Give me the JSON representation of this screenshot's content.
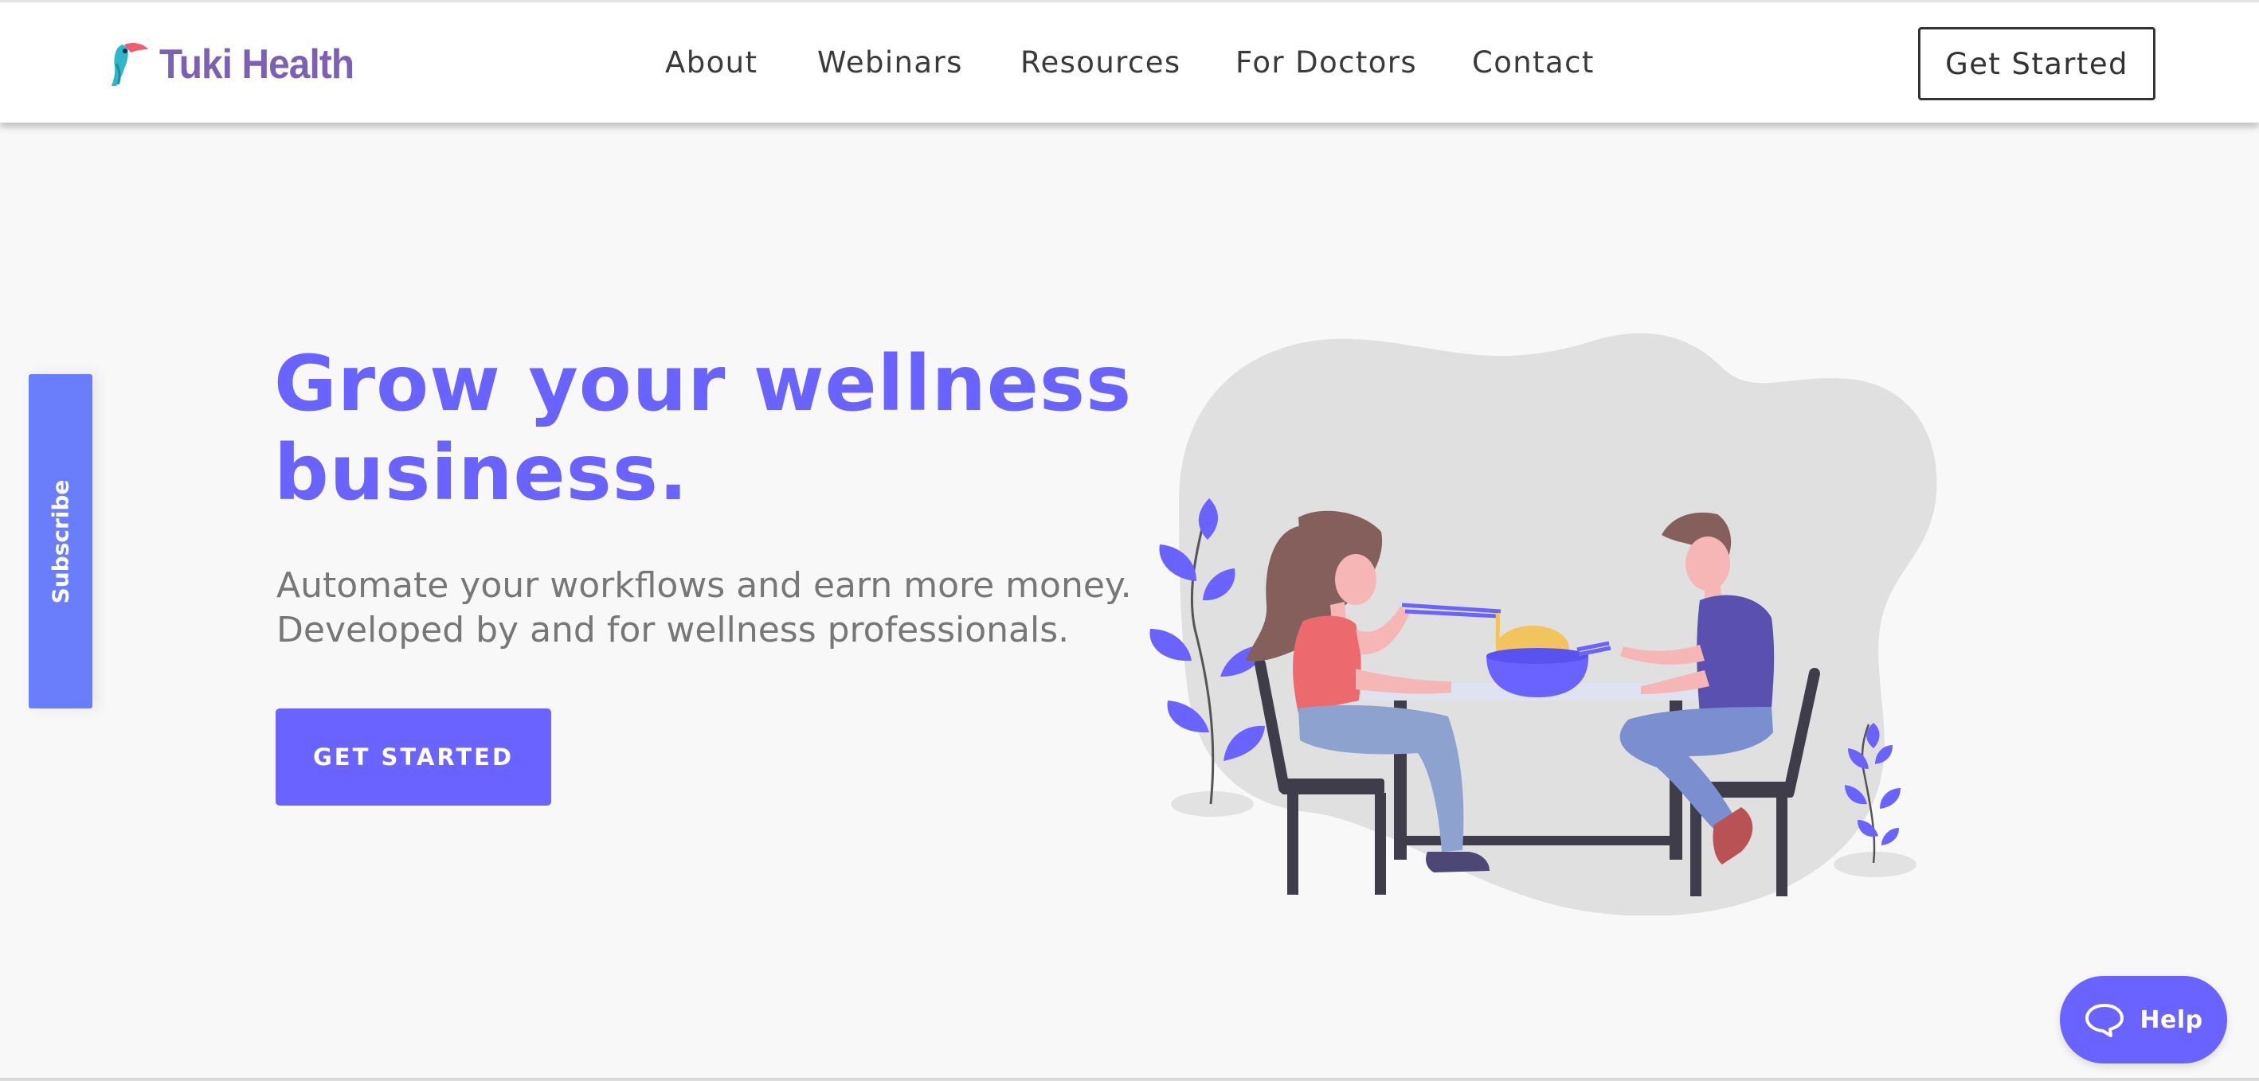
{
  "brand": {
    "name": "Tuki Health",
    "logo_icon": "toucan-logo-icon"
  },
  "nav": {
    "items": [
      {
        "label": "About"
      },
      {
        "label": "Webinars"
      },
      {
        "label": "Resources"
      },
      {
        "label": "For Doctors"
      },
      {
        "label": "Contact"
      }
    ],
    "cta_label": "Get Started"
  },
  "subscribe_tab": {
    "label": "Subscribe"
  },
  "hero": {
    "title_line1": "Grow your wellness",
    "title_line2": "business.",
    "subtitle_line1": "Automate your workflows and earn more money.",
    "subtitle_line2": "Developed by and for wellness professionals.",
    "cta_label": "GET STARTED",
    "illustration": "couple-eating-noodles-illustration"
  },
  "help_widget": {
    "label": "Help",
    "icon": "chat-bubble-icon"
  },
  "colors": {
    "brand_text": "#7b60b3",
    "primary": "#6b63ff",
    "subscribe": "#6a7dfb",
    "body_text": "#777777",
    "nav_text": "#3a3a3a",
    "background": "#f8f8f8"
  }
}
